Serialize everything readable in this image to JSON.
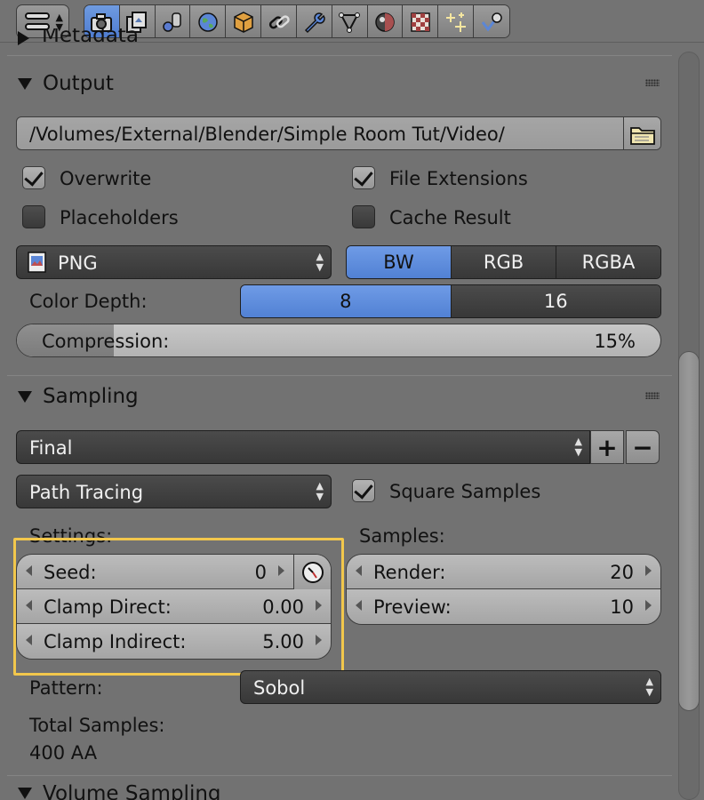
{
  "toolbar": {
    "context_icons": [
      "context-toggle-icon"
    ],
    "tabs": [
      {
        "icon": "camera-render-icon",
        "active": true
      },
      {
        "icon": "render-layers-icon",
        "active": false
      },
      {
        "icon": "scene-icon",
        "active": false
      },
      {
        "icon": "world-icon",
        "active": false
      },
      {
        "icon": "object-icon",
        "active": false
      },
      {
        "icon": "constraints-icon",
        "active": false
      },
      {
        "icon": "modifiers-wrench-icon",
        "active": false
      },
      {
        "icon": "object-data-vertex-icon",
        "active": false
      },
      {
        "icon": "material-icon",
        "active": false
      },
      {
        "icon": "texture-checker-icon",
        "active": false
      },
      {
        "icon": "particles-icon",
        "active": false
      },
      {
        "icon": "physics-icon",
        "active": false
      }
    ]
  },
  "panels": {
    "metadata": {
      "title": "Metadata"
    },
    "output": {
      "title": "Output",
      "path": "/Volumes/External/Blender/Simple Room Tut/Video/",
      "overwrite": {
        "label": "Overwrite",
        "checked": true
      },
      "file_extensions": {
        "label": "File Extensions",
        "checked": true
      },
      "placeholders": {
        "label": "Placeholders",
        "checked": false
      },
      "cache_result": {
        "label": "Cache Result",
        "checked": false
      },
      "format": "PNG",
      "color_modes": [
        {
          "label": "BW",
          "active": true
        },
        {
          "label": "RGB",
          "active": false
        },
        {
          "label": "RGBA",
          "active": false
        }
      ],
      "color_depth_label": "Color Depth:",
      "color_depths": [
        {
          "label": "8",
          "active": true
        },
        {
          "label": "16",
          "active": false
        }
      ],
      "compression_label": "Compression:",
      "compression_value": "15%",
      "compression_fraction": 0.15
    },
    "sampling": {
      "title": "Sampling",
      "preset": "Final",
      "add_label": "+",
      "remove_label": "−",
      "integrator": "Path Tracing",
      "square_samples": {
        "label": "Square Samples",
        "checked": true
      },
      "settings_label": "Settings:",
      "samples_label": "Samples:",
      "settings": [
        {
          "label": "Seed:",
          "value": "0"
        },
        {
          "label": "Clamp Direct:",
          "value": "0.00"
        },
        {
          "label": "Clamp Indirect:",
          "value": "5.00"
        }
      ],
      "samples": [
        {
          "label": "Render:",
          "value": "20"
        },
        {
          "label": "Preview:",
          "value": "10"
        }
      ],
      "pattern_label": "Pattern:",
      "pattern": "Sobol",
      "total_samples_label": "Total Samples:",
      "total_samples_value": "400 AA"
    },
    "volume_sampling": {
      "title": "Volume Sampling"
    }
  }
}
